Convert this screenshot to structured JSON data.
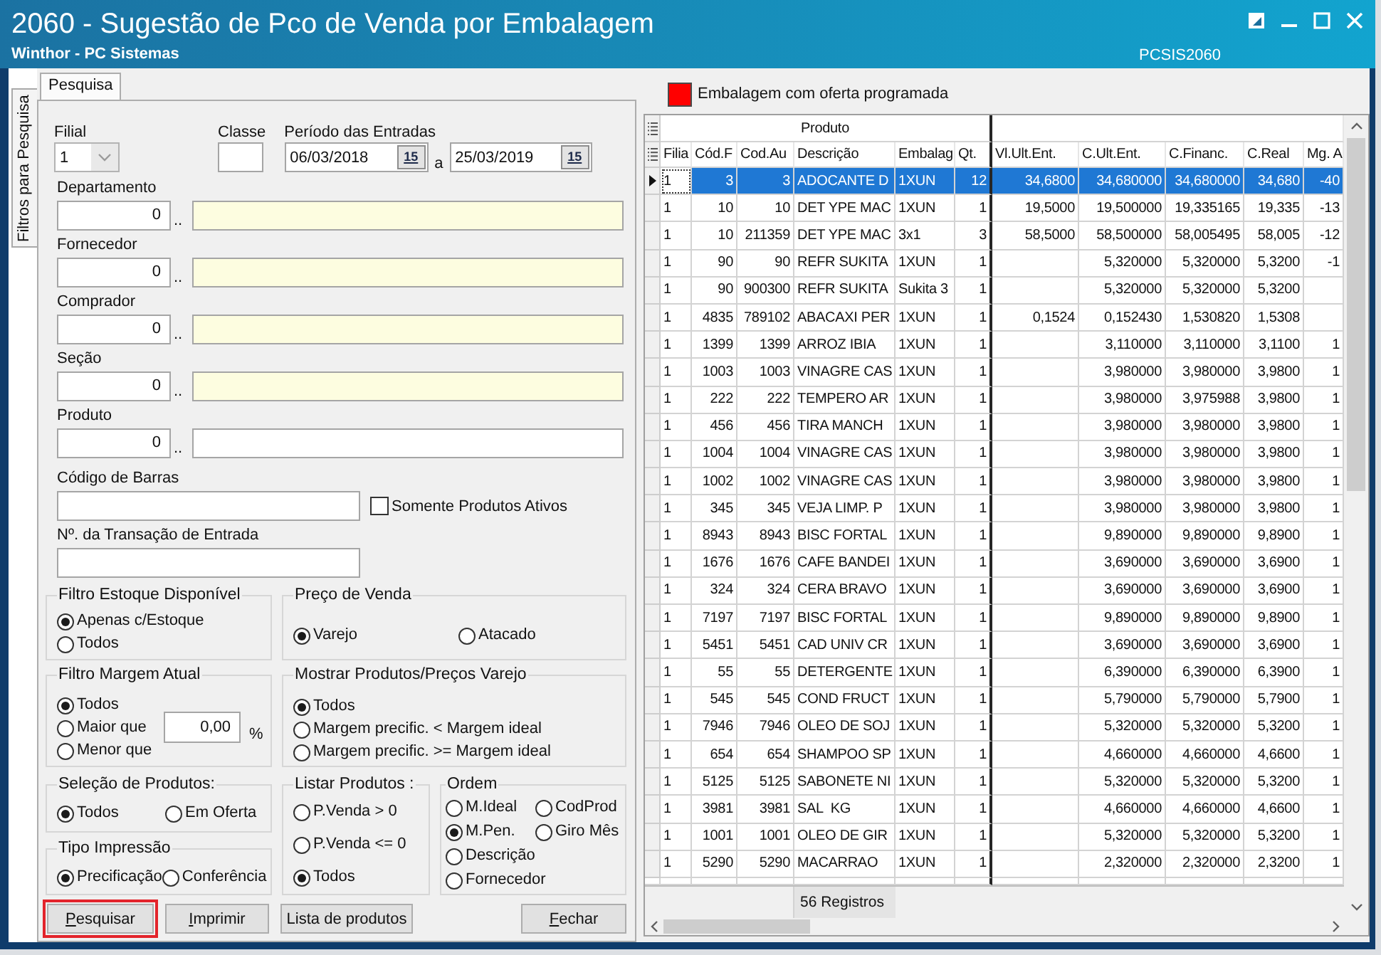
{
  "window": {
    "title": "2060 - Sugestão de Pco de Venda por Embalagem",
    "subtitle": "Winthor - PC Sistemas",
    "program_code": "PCSIS2060"
  },
  "side_tabs": [
    {
      "label": "Filtros para Pesquisa",
      "selected": true
    }
  ],
  "tabs": [
    {
      "label": "Pesquisa",
      "selected": true
    }
  ],
  "filial": {
    "label": "Filial",
    "value": "1"
  },
  "classe": {
    "label": "Classe"
  },
  "period": {
    "label": "Período das Entradas",
    "separator": "a",
    "dates": [
      {
        "value": "06/03/2018",
        "calendar": "15"
      },
      {
        "value": "25/03/2019",
        "calendar": "15"
      }
    ]
  },
  "lookups": [
    {
      "label": "Departamento",
      "code": "0",
      "separator": "..",
      "readonly": true
    },
    {
      "label": "Fornecedor",
      "code": "0",
      "separator": "..",
      "readonly": true
    },
    {
      "label": "Comprador",
      "code": "0",
      "separator": "..",
      "readonly": true
    },
    {
      "label": "Seção",
      "code": "0",
      "separator": "..",
      "readonly": true
    },
    {
      "label": "Produto",
      "code": "0",
      "separator": "..",
      "readonly": false
    }
  ],
  "barcode": {
    "label": "Código de Barras"
  },
  "active_only": {
    "label": "Somente Produtos Ativos",
    "checked": false
  },
  "transaction": {
    "label": "Nº. da Transação de Entrada"
  },
  "stock_filter": {
    "title": "Filtro Estoque Disponível",
    "options": [
      {
        "label": "Apenas c/Estoque",
        "selected": true
      },
      {
        "label": "Todos",
        "selected": false
      }
    ]
  },
  "sale_price": {
    "title": "Preço de Venda",
    "options": [
      {
        "label": "Varejo",
        "selected": true
      },
      {
        "label": "Atacado",
        "selected": false
      }
    ]
  },
  "margin_filter": {
    "title": "Filtro Margem Atual",
    "options": [
      {
        "label": "Todos",
        "selected": true
      },
      {
        "label": "Maior que",
        "selected": false
      },
      {
        "label": "Menor que",
        "selected": false
      }
    ],
    "value": "0,00",
    "unit": "%"
  },
  "show_products": {
    "title": "Mostrar Produtos/Preços Varejo",
    "options": [
      {
        "label": "Todos",
        "selected": true
      },
      {
        "label": "Margem precific. < Margem ideal",
        "selected": false
      },
      {
        "label": "Margem precific. >= Margem ideal",
        "selected": false
      }
    ]
  },
  "product_selection": {
    "title": "Seleção de Produtos:",
    "options": [
      {
        "label": "Todos",
        "selected": true
      },
      {
        "label": "Em Oferta",
        "selected": false
      }
    ]
  },
  "print_type": {
    "title": "Tipo Impressão",
    "options": [
      {
        "label": "Precificação",
        "selected": true
      },
      {
        "label": "Conferência",
        "selected": false
      }
    ]
  },
  "list_products": {
    "title": "Listar Produtos :",
    "options": [
      {
        "label": "P.Venda > 0",
        "selected": false
      },
      {
        "label": "P.Venda <= 0",
        "selected": false
      },
      {
        "label": "Todos",
        "selected": true
      }
    ]
  },
  "order": {
    "title": "Ordem",
    "options": [
      {
        "label": "M.Ideal",
        "selected": false
      },
      {
        "label": "CodProd",
        "selected": false
      },
      {
        "label": "M.Pen.",
        "selected": true
      },
      {
        "label": "Giro Mês",
        "selected": false
      },
      {
        "label": "Descrição",
        "selected": false
      },
      {
        "label": "Fornecedor",
        "selected": false
      }
    ]
  },
  "buttons": [
    {
      "label": "Pesquisar",
      "underline_first": true,
      "highlighted": true
    },
    {
      "label": "Imprimir",
      "underline_first": true,
      "highlighted": false
    },
    {
      "label": "Lista de produtos",
      "underline_first": false,
      "highlighted": false
    },
    {
      "label": "Fechar",
      "underline_first": true,
      "highlighted": false
    }
  ],
  "legend": [
    {
      "label": "Embalagem com oferta programada",
      "color": "#ff0000"
    }
  ],
  "grid": {
    "group_header": "Produto",
    "columns": [
      "Filia",
      "Cód.F",
      "Cod.Au",
      "Descrição",
      "Embalag",
      "Qt.",
      "Vl.Ult.Ent.",
      "C.Ult.Ent.",
      "C.Financ.",
      "C.Real",
      "Mg. A"
    ],
    "rows": [
      {
        "selected": true,
        "cells": [
          "1",
          "3",
          "3",
          "ADOCANTE D",
          "1XUN",
          "12",
          "34,6800",
          "34,680000",
          "34,680000",
          "34,680",
          "-40"
        ]
      },
      {
        "selected": false,
        "cells": [
          "1",
          "10",
          "10",
          "DET YPE MAC",
          "1XUN",
          "1",
          "19,5000",
          "19,500000",
          "19,335165",
          "19,335",
          "-13"
        ]
      },
      {
        "selected": false,
        "cells": [
          "1",
          "10",
          "211359",
          "DET YPE MAC",
          "3x1",
          "3",
          "58,5000",
          "58,500000",
          "58,005495",
          "58,005",
          "-12"
        ]
      },
      {
        "selected": false,
        "cells": [
          "1",
          "90",
          "90",
          "REFR SUKITA",
          "1XUN",
          "1",
          null,
          "5,320000",
          "5,320000",
          "5,3200",
          "-1"
        ]
      },
      {
        "selected": false,
        "cells": [
          "1",
          "90",
          "900300",
          "REFR SUKITA",
          "Sukita 3",
          "1",
          null,
          "5,320000",
          "5,320000",
          "5,3200",
          null
        ]
      },
      {
        "selected": false,
        "cells": [
          "1",
          "4835",
          "789102",
          "ABACAXI PER",
          "1XUN",
          "1",
          "0,1524",
          "0,152430",
          "1,530820",
          "1,5308",
          null
        ]
      },
      {
        "selected": false,
        "cells": [
          "1",
          "1399",
          "1399",
          "ARROZ IBIA",
          "1XUN",
          "1",
          null,
          "3,110000",
          "3,110000",
          "3,1100",
          "1"
        ]
      },
      {
        "selected": false,
        "cells": [
          "1",
          "1003",
          "1003",
          "VINAGRE CAS",
          "1XUN",
          "1",
          null,
          "3,980000",
          "3,980000",
          "3,9800",
          "1"
        ]
      },
      {
        "selected": false,
        "cells": [
          "1",
          "222",
          "222",
          "TEMPERO AR",
          "1XUN",
          "1",
          null,
          "3,980000",
          "3,975988",
          "3,9800",
          "1"
        ]
      },
      {
        "selected": false,
        "cells": [
          "1",
          "456",
          "456",
          "TIRA MANCH",
          "1XUN",
          "1",
          null,
          "3,980000",
          "3,980000",
          "3,9800",
          "1"
        ]
      },
      {
        "selected": false,
        "cells": [
          "1",
          "1004",
          "1004",
          "VINAGRE CAS",
          "1XUN",
          "1",
          null,
          "3,980000",
          "3,980000",
          "3,9800",
          "1"
        ]
      },
      {
        "selected": false,
        "cells": [
          "1",
          "1002",
          "1002",
          "VINAGRE CAS",
          "1XUN",
          "1",
          null,
          "3,980000",
          "3,980000",
          "3,9800",
          "1"
        ]
      },
      {
        "selected": false,
        "cells": [
          "1",
          "345",
          "345",
          "VEJA LIMP. P",
          "1XUN",
          "1",
          null,
          "3,980000",
          "3,980000",
          "3,9800",
          "1"
        ]
      },
      {
        "selected": false,
        "cells": [
          "1",
          "8943",
          "8943",
          "BISC FORTAL",
          "1XUN",
          "1",
          null,
          "9,890000",
          "9,890000",
          "9,8900",
          "1"
        ]
      },
      {
        "selected": false,
        "cells": [
          "1",
          "1676",
          "1676",
          "CAFE BANDEI",
          "1XUN",
          "1",
          null,
          "3,690000",
          "3,690000",
          "3,6900",
          "1"
        ]
      },
      {
        "selected": false,
        "cells": [
          "1",
          "324",
          "324",
          "CERA BRAVO",
          "1XUN",
          "1",
          null,
          "3,690000",
          "3,690000",
          "3,6900",
          "1"
        ]
      },
      {
        "selected": false,
        "cells": [
          "1",
          "7197",
          "7197",
          "BISC FORTAL",
          "1XUN",
          "1",
          null,
          "9,890000",
          "9,890000",
          "9,8900",
          "1"
        ]
      },
      {
        "selected": false,
        "cells": [
          "1",
          "5451",
          "5451",
          "CAD UNIV CR",
          "1XUN",
          "1",
          null,
          "3,690000",
          "3,690000",
          "3,6900",
          "1"
        ]
      },
      {
        "selected": false,
        "cells": [
          "1",
          "55",
          "55",
          "DETERGENTE",
          "1XUN",
          "1",
          null,
          "6,390000",
          "6,390000",
          "6,3900",
          "1"
        ]
      },
      {
        "selected": false,
        "cells": [
          "1",
          "545",
          "545",
          "COND FRUCT",
          "1XUN",
          "1",
          null,
          "5,790000",
          "5,790000",
          "5,7900",
          "1"
        ]
      },
      {
        "selected": false,
        "cells": [
          "1",
          "7946",
          "7946",
          "OLEO DE SOJ",
          "1XUN",
          "1",
          null,
          "5,320000",
          "5,320000",
          "5,3200",
          "1"
        ]
      },
      {
        "selected": false,
        "cells": [
          "1",
          "654",
          "654",
          "SHAMPOO SP",
          "1XUN",
          "1",
          null,
          "4,660000",
          "4,660000",
          "4,6600",
          "1"
        ]
      },
      {
        "selected": false,
        "cells": [
          "1",
          "5125",
          "5125",
          "SABONETE NI",
          "1XUN",
          "1",
          null,
          "5,320000",
          "5,320000",
          "5,3200",
          "1"
        ]
      },
      {
        "selected": false,
        "cells": [
          "1",
          "3981",
          "3981",
          "SAL  KG",
          "1XUN",
          "1",
          null,
          "4,660000",
          "4,660000",
          "4,6600",
          "1"
        ]
      },
      {
        "selected": false,
        "cells": [
          "1",
          "1001",
          "1001",
          "OLEO DE GIR",
          "1XUN",
          "1",
          null,
          "5,320000",
          "5,320000",
          "5,3200",
          "1"
        ]
      },
      {
        "selected": false,
        "cells": [
          "1",
          "5290",
          "5290",
          "MACARRAO",
          "1XUN",
          "1",
          null,
          "2,320000",
          "2,320000",
          "2,3200",
          "1"
        ]
      }
    ],
    "footer": "56 Registros"
  }
}
